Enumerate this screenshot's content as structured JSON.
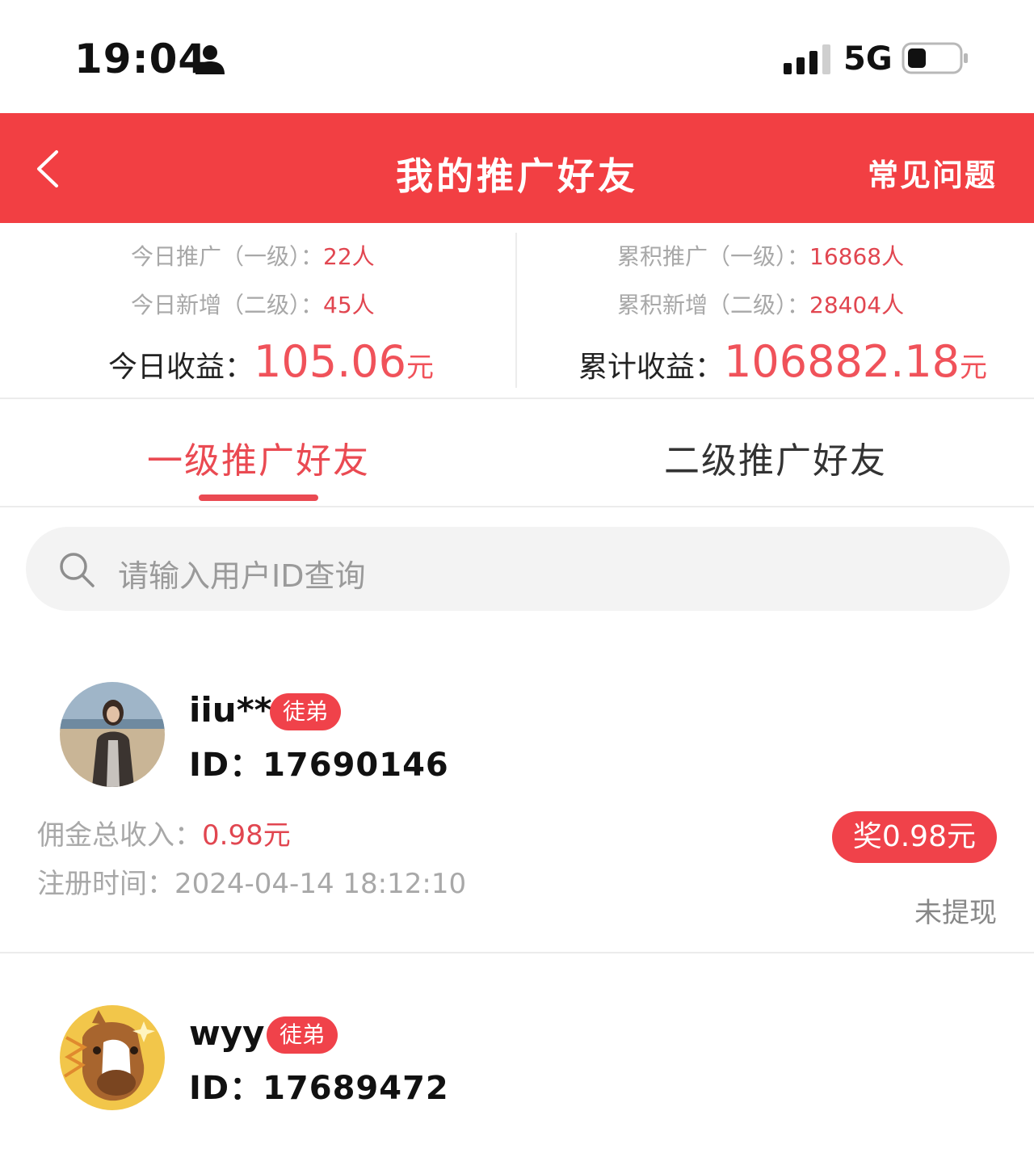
{
  "status_bar": {
    "time": "19:04",
    "network": "5G"
  },
  "header": {
    "title": "我的推广好友",
    "faq": "常见问题"
  },
  "stats": {
    "today_promo_label": "今日推广（一级）：",
    "today_promo_value": "22人",
    "today_new_label": "今日新增（二级）：",
    "today_new_value": "45人",
    "today_income_label": "今日收益：",
    "today_income_amount": "105.06",
    "today_income_unit": "元",
    "total_promo_label": "累积推广（一级）：",
    "total_promo_value": "16868人",
    "total_new_label": "累积新增（二级）：",
    "total_new_value": "28404人",
    "total_income_label": "累计收益：",
    "total_income_amount": "106882.18",
    "total_income_unit": "元"
  },
  "tabs": {
    "level1": "一级推广好友",
    "level2": "二级推广好友"
  },
  "search": {
    "placeholder": "请输入用户ID查询"
  },
  "friends": [
    {
      "name": "iiu**",
      "badge": "徒弟",
      "id": "ID：17690146",
      "commission_label": "佣金总收入：",
      "commission_value": "0.98元",
      "reg_time": "注册时间：2024-04-14 18:12:10",
      "reward": "奖0.98元",
      "status": "未提现"
    },
    {
      "name": "wyy",
      "badge": "徒弟",
      "id": "ID：17689472"
    }
  ],
  "colors": {
    "brand_red": "#f23f43",
    "accent_text": "#e14650"
  }
}
